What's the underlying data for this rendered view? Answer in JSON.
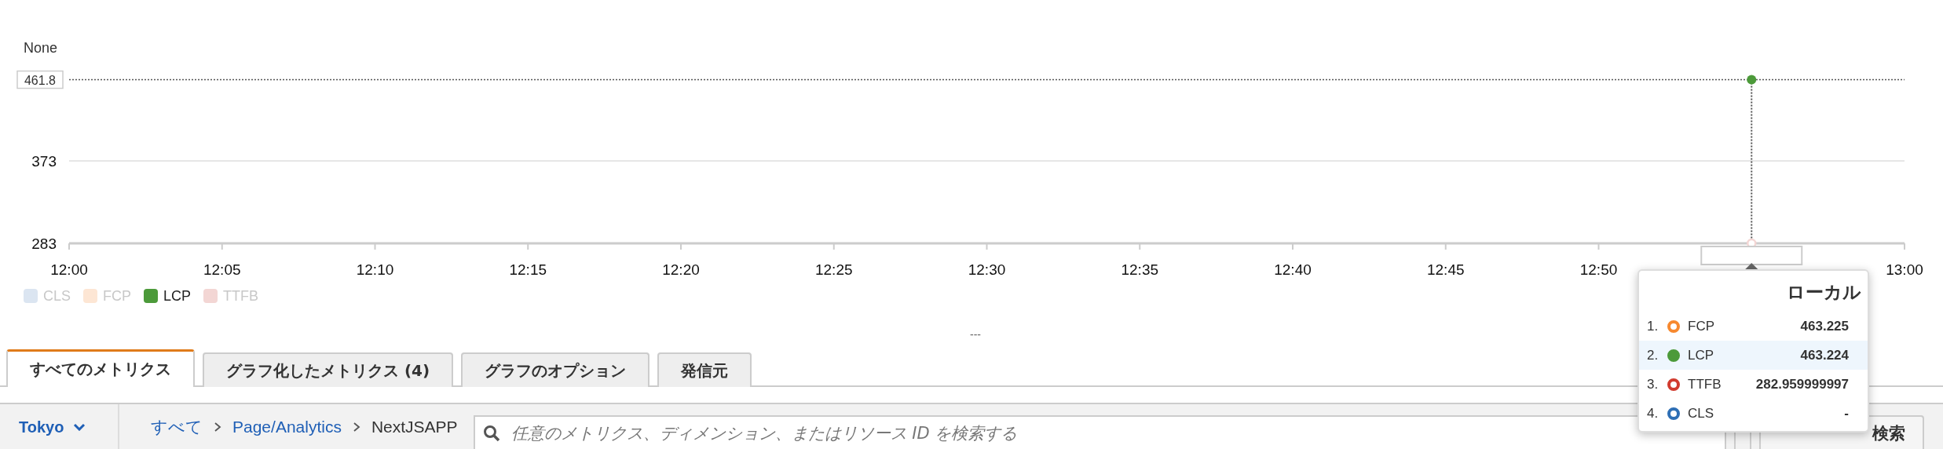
{
  "chart": {
    "unit_label": "None",
    "crosshair_label": "461.8",
    "chart_data": {
      "type": "line",
      "categories": [
        "12:00",
        "12:05",
        "12:10",
        "12:15",
        "12:20",
        "12:25",
        "12:30",
        "12:35",
        "12:40",
        "12:45",
        "12:50",
        null,
        "13:00"
      ],
      "ylim": [
        283,
        461.8
      ],
      "yticks": [
        283,
        373
      ],
      "ref_lines": [
        {
          "axis": "y",
          "value": 373
        }
      ],
      "series": [
        {
          "name": "CLS",
          "color": "#dbe5f1",
          "values": [
            null,
            null,
            null,
            null,
            null,
            null,
            null,
            null,
            null,
            null,
            null,
            null,
            null
          ]
        },
        {
          "name": "FCP",
          "color": "#fde6d4",
          "values": [
            null,
            null,
            null,
            null,
            null,
            null,
            null,
            null,
            null,
            null,
            null,
            null,
            null
          ]
        },
        {
          "name": "LCP",
          "color": "#4c9a3a",
          "marker": "circle",
          "values": [
            null,
            null,
            null,
            null,
            null,
            null,
            null,
            null,
            null,
            null,
            null,
            461.8,
            null
          ]
        },
        {
          "name": "TTFB",
          "color": "#f3d6d4",
          "marker": "circle",
          "values": [
            null,
            null,
            null,
            null,
            null,
            null,
            null,
            null,
            null,
            null,
            null,
            283,
            null
          ]
        }
      ]
    },
    "legend": [
      {
        "enabled": false
      },
      {
        "enabled": false
      },
      {
        "enabled": true
      },
      {
        "enabled": false
      }
    ]
  },
  "resize_handle": "---",
  "tooltip": {
    "title": "ローカル",
    "rows": [
      {
        "index": "1.",
        "name": "FCP",
        "value": "463.225",
        "color": "#f7892f",
        "selected": false
      },
      {
        "index": "2.",
        "name": "LCP",
        "value": "463.224",
        "color": "#4c9a3a",
        "selected": true
      },
      {
        "index": "3.",
        "name": "TTFB",
        "value": "282.959999997",
        "color": "#d13b2f",
        "selected": false
      },
      {
        "index": "4.",
        "name": "CLS",
        "value": "-",
        "color": "#2e6fb5",
        "selected": false
      }
    ]
  },
  "tabs": [
    {
      "label": "すべてのメトリクス",
      "selected": true
    },
    {
      "label": "グラフ化したメトリクス (4)",
      "selected": false
    },
    {
      "label": "グラフのオプション",
      "selected": false
    },
    {
      "label": "発信元",
      "selected": false
    }
  ],
  "toolbar": {
    "region": "Tokyo",
    "breadcrumb": [
      {
        "label": "すべて",
        "link": true
      },
      {
        "label": "Page/Analytics",
        "link": true
      },
      {
        "label": "NextJSAPP",
        "link": false
      }
    ],
    "search": {
      "placeholder": "任意のメトリクス、ディメンション、またはリソース ID を検索する"
    },
    "search_button": "検索"
  }
}
